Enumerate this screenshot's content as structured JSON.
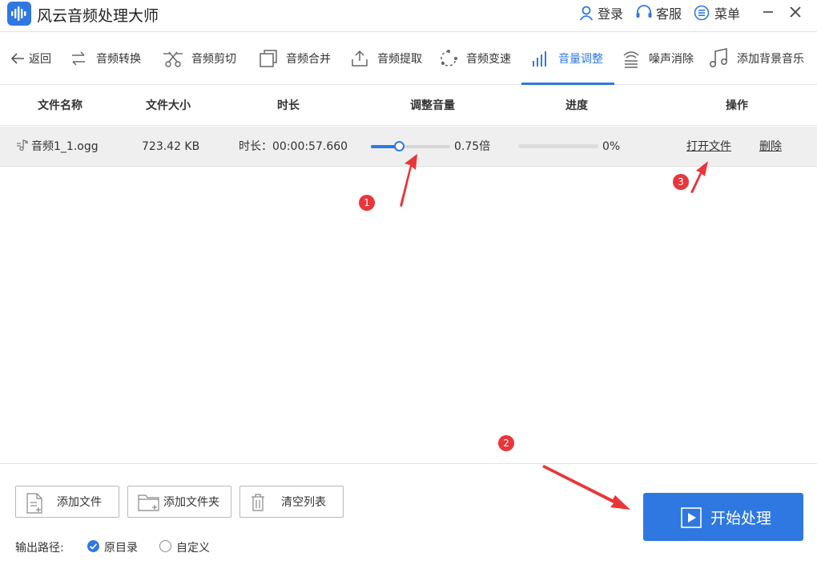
{
  "window": {
    "title": "风云音频处理大师",
    "login_label": "登录",
    "service_label": "客服",
    "menu_label": "菜单"
  },
  "toolbar": {
    "back_label": "返回",
    "tools": [
      {
        "label": "音频转换",
        "icon": "convert-icon"
      },
      {
        "label": "音频剪切",
        "icon": "scissors-icon"
      },
      {
        "label": "音频合并",
        "icon": "merge-icon"
      },
      {
        "label": "音频提取",
        "icon": "upload-icon"
      },
      {
        "label": "音频变速",
        "icon": "speed-icon"
      },
      {
        "label": "音量调整",
        "icon": "volume-bars-icon",
        "active": true
      },
      {
        "label": "噪声消除",
        "icon": "noise-icon"
      },
      {
        "label": "添加背景音乐",
        "icon": "music-note-icon"
      }
    ]
  },
  "table": {
    "headers": [
      "文件名称",
      "文件大小",
      "时长",
      "调整音量",
      "进度",
      "操作"
    ],
    "rows": [
      {
        "name": "音频1_1.ogg",
        "size": "723.42 KB",
        "duration": "时长：00:00:57.660",
        "volume_text": "0.75倍",
        "volume_fraction": 0.35,
        "progress_text": "0%",
        "progress_fraction": 0,
        "open_label": "打开文件",
        "delete_label": "删除"
      }
    ]
  },
  "annotations": [
    "1",
    "2",
    "3"
  ],
  "bottom": {
    "add_file_label": "添加文件",
    "add_folder_label": "添加文件夹",
    "clear_list_label": "清空列表",
    "start_label": "开始处理",
    "output_path_label": "输出路径:",
    "option_original": "原目录",
    "option_custom": "自定义",
    "selected_option": "原目录"
  },
  "colors": {
    "accent": "#2f78e2",
    "annotation": "#e8363a"
  }
}
